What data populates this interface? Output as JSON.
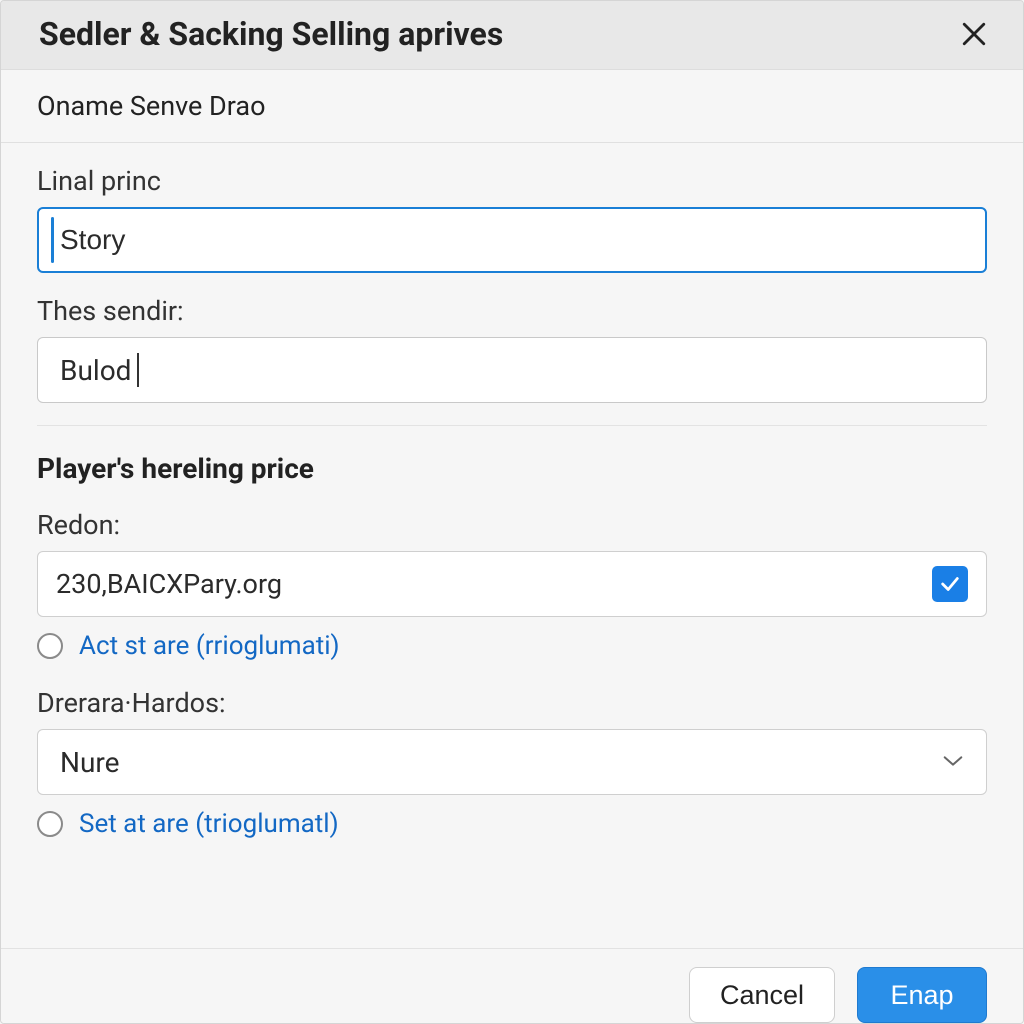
{
  "titlebar": {
    "title": "Sedler & Sacking Selling aprives"
  },
  "subheader": {
    "text": "Oname Senve Drao"
  },
  "section1": {
    "linal_label": "Linal princ",
    "linal_value": "Story",
    "thes_label": "Thes sendir:",
    "thes_value": "Bulod"
  },
  "section2": {
    "heading": "Player's hereling price",
    "redon_label": "Redon:",
    "redon_value": "230,BAICXPary.org",
    "radio1_label": "Act st are (rrioglumati)",
    "drerara_label": "Drerara·Hardos:",
    "drerara_value": "Nure",
    "radio2_label": "Set at are (trioglumatl)"
  },
  "footer": {
    "cancel": "Cancel",
    "primary": "Enap"
  }
}
